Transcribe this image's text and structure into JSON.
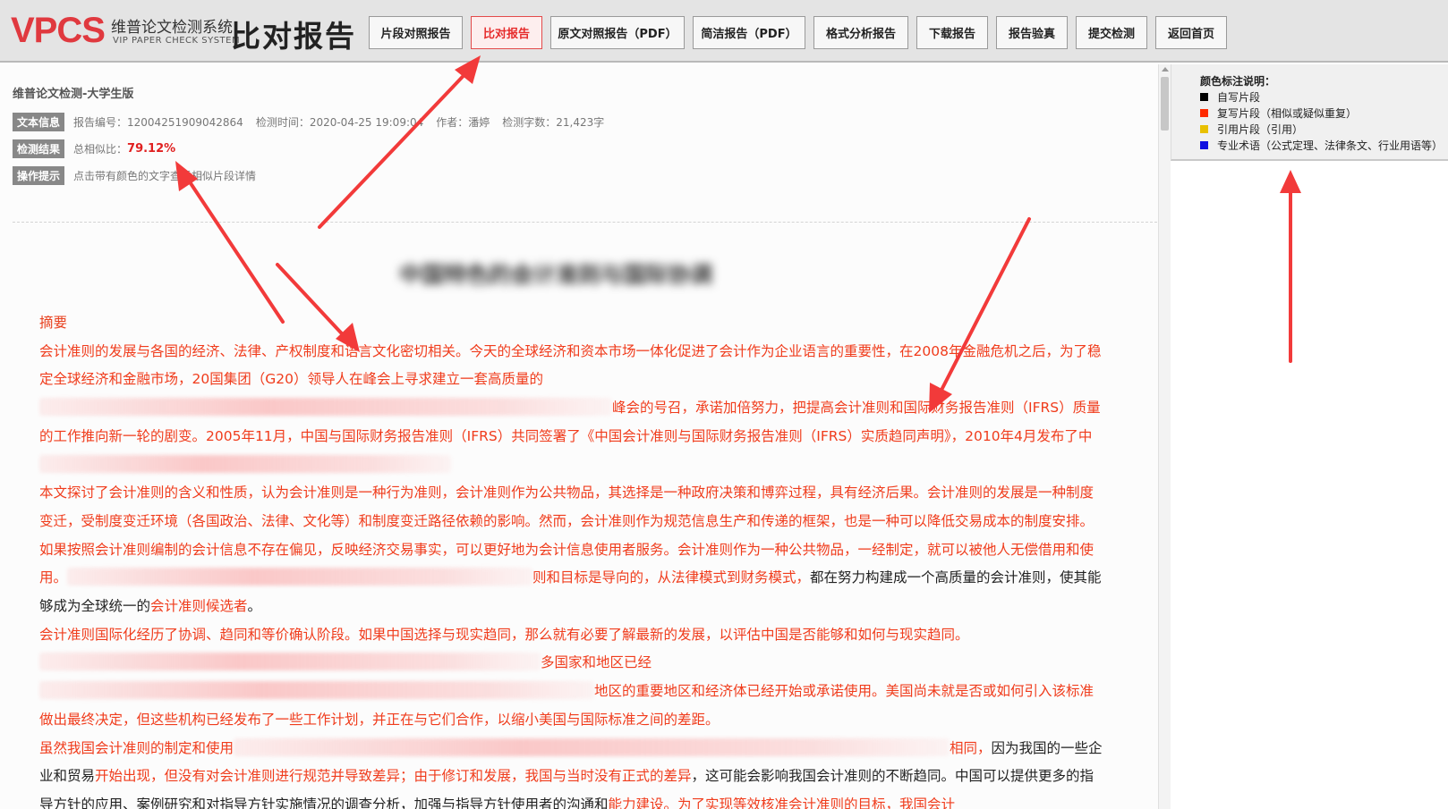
{
  "header": {
    "logo_mark": "VPCS",
    "logo_cn": "维普论文检测系统",
    "logo_en": "VIP PAPER CHECK SYSTEM",
    "logo_title": "比对报告",
    "nav": [
      {
        "label": "片段对照报告"
      },
      {
        "label": "比对报告",
        "active": true
      },
      {
        "label": "原文对照报告（PDF）"
      },
      {
        "label": "简洁报告（PDF）"
      },
      {
        "label": "格式分析报告"
      },
      {
        "label": "下载报告"
      },
      {
        "label": "报告验真"
      },
      {
        "label": "提交检测"
      },
      {
        "label": "返回首页"
      }
    ]
  },
  "info": {
    "version": "维普论文检测-大学生版",
    "text_info_tag": "文本信息",
    "report_no": "报告编号：12004251909042864",
    "check_time": "检测时间：2020-04-25 19:09:04",
    "author": "作者：潘婷",
    "word_count": "检测字数：21,423字",
    "result_tag": "检测结果",
    "similarity_label": "总相似比：",
    "similarity_value": "79.12%",
    "tip_tag": "操作提示",
    "tip_text": "点击带有颜色的文字查看相似片段详情"
  },
  "document": {
    "title": "中国特色的会计准则与国际协调",
    "abstract_heading": "摘要",
    "p1_a": "会计准则的发展与各国的经济、法律、产权制度和语言文化密切相关。今天的全球经济和资本市场一体化促进了会计作为企业语言的重要性，在2008年金融危机之后，为了稳定全球经济和金融市场，20国集团（G20）领导人在峰会上寻求建立一套高质量的",
    "p1_b": "峰会的号召，承诺加倍努力，把提高会计准则和国际财务报告准则（IFRS）质量的工作推向新一轮的剧变。2005年11月，中国与国际财务报告准则（IFRS）共同签署了《中国会计准则与国际财务报告准则（IFRS）实质趋同声明》，2010年4月发布了中",
    "p2_a": "本文探讨了会计准则的含义和性质，认为会计准则是一种行为准则，会计准则作为公共物品，其选择是一种政府决策和博弈过程，具有经济后果。会计准则的发展是一种制度变迁，受制度变迁环境（各国政治、法律、文化等）和制度变迁路径依赖的影响。然而，会计准则作为规范信息生产和传递的框架，也是一种可以降低交易成本的制度安排。如果按照会计准则编制的会计信息不存在偏见，反映经济交易事实，可以更好地为会计信息使用者服务。会计准则作为一种公共物品，一经制定，就可以被他人无偿借用和使用。",
    "p2_b": "则和目标是导向的，从法律模式到财务模式，",
    "p2_c": "都在努力构建成一个高质量的会计准则，使其能够成为全球统一的",
    "p2_d": "会计准则候选者",
    "p2_e": "。",
    "p3_a": "会计准则国际化经历了协调、趋同和等价确认阶段。如果中国选择与现实趋同，那么就有必要了解最新的发展，以评估中国是否能够和如何与现实趋同。",
    "p3_b": "多国家和地区已经",
    "p3_c": "地区的重要地区和经济体已经开始或承诺使用。美国尚未就是否或如何引入该标准做出最终决定，但这些机构已经发布了一些工作计划，并正在与它们合作，以缩小美国与国际标准之间的差距。",
    "p4_a": "虽然我国会计准则的制定和使用",
    "p4_b": "相同，",
    "p4_c": "因为我国的一些企业和贸易",
    "p4_d": "开始出现，但没有对会计准则进行规范并导致差异；由于修订和发展，我国与当时没有正式的差异",
    "p4_e": "，这可能会影响我国会计准则的不断趋同。中国可以提供更多的指导方针的应用、案例研究和对指导方针实施情况的调查分析，加强与指导方针使用者的沟通和",
    "p4_f": "能力建设。为了实现等效核准会计准则的目标，我国会计"
  },
  "legend": {
    "title": "颜色标注说明：",
    "items": [
      {
        "label": "自写片段",
        "color": "#000000"
      },
      {
        "label": "复写片段（相似或疑似重复）",
        "color": "#ff2a00"
      },
      {
        "label": "引用片段（引用）",
        "color": "#e8c000"
      },
      {
        "label": "专业术语（公式定理、法律条文、行业用语等）",
        "color": "#1010e0"
      }
    ]
  },
  "colors": {
    "accent_red": "#e62c2c",
    "annotation_red": "#f23a3a"
  }
}
